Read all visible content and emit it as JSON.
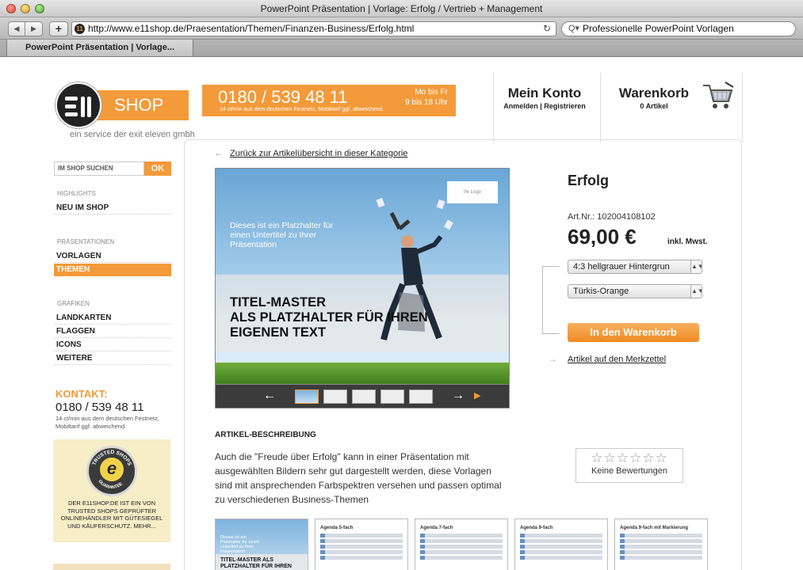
{
  "window": {
    "title": "PowerPoint Präsentation | Vorlage: Erfolg / Vertrieb + Management"
  },
  "toolbar": {
    "url": "http://www.e11shop.de/Praesentation/Themen/Finanzen-Business/Erfolg.html",
    "search_value": "Professionelle PowerPoint Vorlagen"
  },
  "tab": {
    "label": "PowerPoint Präsentation | Vorlage..."
  },
  "header": {
    "logo_text": "SHOP",
    "tagline": "ein service der exit eleven gmbh",
    "phone": "0180 / 539 48 11",
    "hours_line1": "Mo bis Fr",
    "hours_line2": "9 bis 18 Uhr",
    "phone_note": "14 ct/min aus dem deutschen Festnetz, Mobiltarif ggf. abweichend.",
    "account_title": "Mein Konto",
    "account_links": "Anmelden | Registrieren",
    "cart_title": "Warenkorb",
    "cart_count": "0 Artikel"
  },
  "sidebar": {
    "search_label": "IM SHOP SUCHEN",
    "search_button": "OK",
    "highlights_head": "HIGHLIGHTS",
    "highlights": [
      "NEU IM SHOP"
    ],
    "presentations_head": "PRÄSENTATIONEN",
    "presentations": [
      "VORLAGEN",
      "THEMEN"
    ],
    "graphics_head": "GRAFIKEN",
    "graphics": [
      "LANDKARTEN",
      "FLAGGEN",
      "ICONS",
      "WEITERE"
    ],
    "contact_title": "KONTAKT:",
    "contact_phone": "0180 / 539 48 11",
    "contact_note": "14 ct/min aus dem deutschen Festnetz, Mobiltarif ggf. abweichend.",
    "trusted_text": "DER E11SHOP.DE IST EIN VON TRUSTED SHOPS GEPRÜFTER ONLINEHÄNDLER MIT GÜTESIEGEL UND KÄUFERSCHUTZ. MEHR...",
    "trusted_seal_top": "TRUSTED SHOPS",
    "trusted_seal_bottom": "GUARANTEE"
  },
  "product": {
    "back_link": "Zurück zur Artikelübersicht in dieser Kategorie",
    "title": "Erfolg",
    "art_nr": "Art.Nr.: 102004108102",
    "price": "69,00 €",
    "price_suffix": "inkl. Mwst.",
    "option_background": "4:3 hellgrauer Hintergrun",
    "option_color": "Türkis-Orange",
    "add_to_cart": "In den Warenkorb",
    "watchlist": "Artikel auf den Merkzettel",
    "rating_stars": "☆☆☆☆☆☆",
    "rating_label": "Keine Bewertungen"
  },
  "slide": {
    "logo_placeholder": "Ihr Logo",
    "subtitle": "Dieses ist ein Platzhalter für einen Untertitel zu Ihrer Präsentation",
    "title_line1": "TITEL-MASTER",
    "title_line2": "ALS PLATZHALTER FÜR IHREN",
    "title_line3": "EIGENEN TEXT"
  },
  "description": {
    "heading": "ARTIKEL-BESCHREIBUNG",
    "text": "Auch die \"Freude über Erfolg\" kann in einer Präsentation mit ausgewählten Bildern sehr gut dargestellt werden, diese Vorlagen sind mit ansprechenden Farbspektren versehen und passen optimal zu verschiedenen Business-Themen"
  },
  "previews": {
    "first_sub": "Dieses ist ein Platzhalter für einen Untertitel zu Ihrer Präsentation",
    "first_title": "TITEL-MASTER ALS PLATZHALTER FÜR IHREN",
    "items": [
      "Agenda 5-fach",
      "Agenda 7-fach",
      "Agenda 9-fach",
      "Agenda 9-fach mit Markierung"
    ]
  },
  "colors": {
    "accent": "#f39a3a",
    "text": "#222222"
  }
}
